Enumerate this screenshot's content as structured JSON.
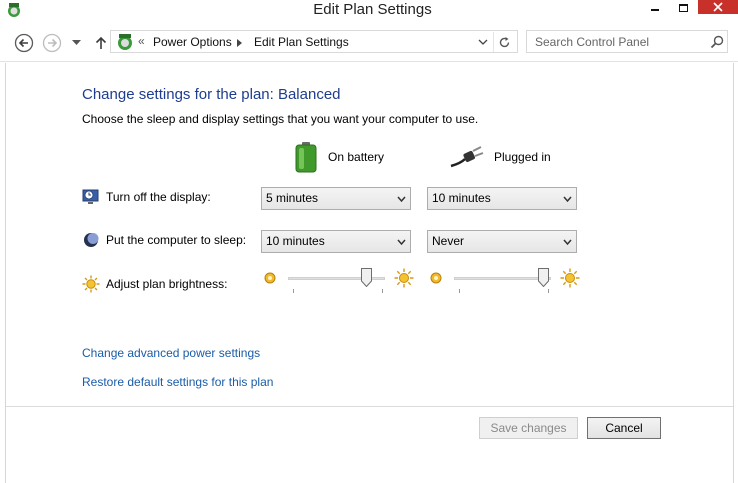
{
  "window": {
    "title": "Edit Plan Settings",
    "close_color": "#c7312a"
  },
  "nav": {
    "breadcrumb_separator": "«",
    "crumbs": [
      "Power Options",
      "Edit Plan Settings"
    ],
    "search_placeholder": "Search Control Panel",
    "icons": [
      "back-arrow-icon",
      "forward-arrow-icon",
      "chevron-down-icon",
      "up-arrow-icon",
      "control-panel-icon",
      "refresh-icon",
      "search-icon"
    ]
  },
  "main": {
    "heading": "Change settings for the plan: Balanced",
    "subheading": "Choose the sleep and display settings that you want your computer to use.",
    "columns": {
      "battery": "On battery",
      "plugged": "Plugged in"
    },
    "display": {
      "label": "Turn off the display:",
      "battery_value": "5 minutes",
      "plugged_value": "10 minutes"
    },
    "sleep": {
      "label": "Put the computer to sleep:",
      "battery_value": "10 minutes",
      "plugged_value": "Never"
    },
    "brightness": {
      "label": "Adjust plan brightness:",
      "battery_level_percent": 85,
      "plugged_level_percent": 98
    },
    "links": {
      "advanced": "Change advanced power settings",
      "restore": "Restore default settings for this plan"
    },
    "accent_color": "#1e3d8f",
    "link_color": "#1a5ca8"
  },
  "footer": {
    "save_label": "Save changes",
    "cancel_label": "Cancel"
  }
}
